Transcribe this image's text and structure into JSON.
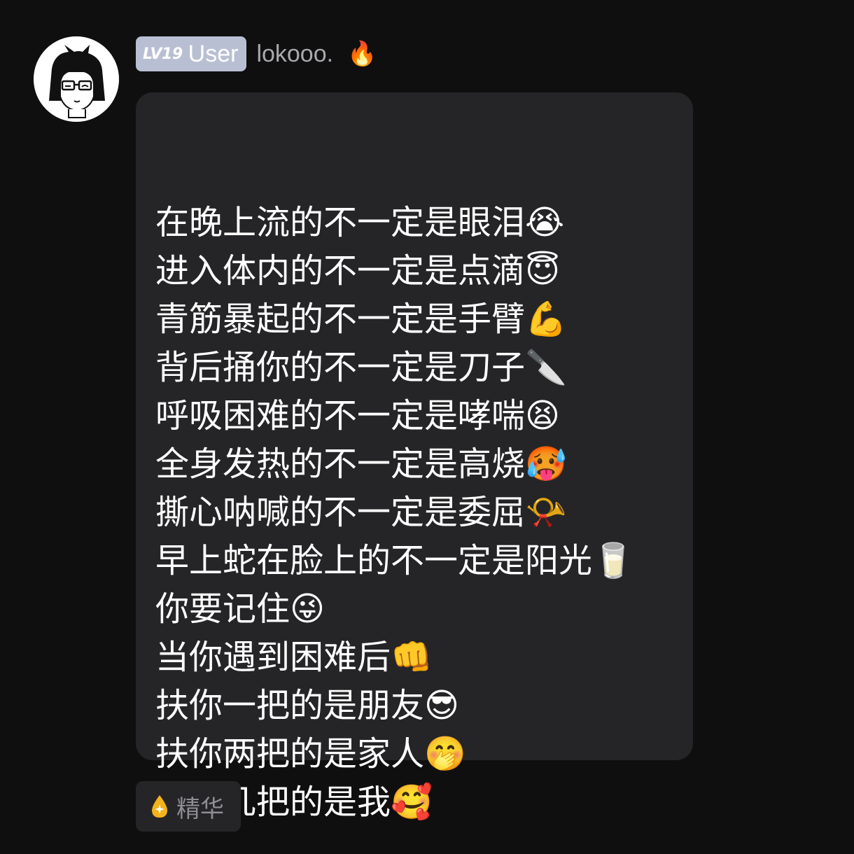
{
  "post": {
    "level": "LV19",
    "role": "User",
    "username": "lokooo.",
    "badge_icon": "fire-icon",
    "lines": [
      "在晚上流的不一定是眼泪😭",
      "进入体内的不一定是点滴😇",
      "青筋暴起的不一定是手臂💪",
      "背后捅你的不一定是刀子🔪",
      "呼吸困难的不一定是哮喘😫",
      "全身发热的不一定是高烧🥵",
      "撕心呐喊的不一定是委屈📯",
      "早上蛇在脸上的不一定是阳光🥛",
      "你要记住😜",
      "当你遇到困难后👊",
      "扶你一把的是朋友😎",
      "扶你两把的是家人🤭",
      "扶你几把的是我🥰"
    ]
  },
  "tag": {
    "label": "精华",
    "icon": "essence-drop-icon"
  },
  "colors": {
    "background": "#0f0f10",
    "bubble": "#252527",
    "level_badge": "#b9bfd3",
    "username": "#a9a9ad",
    "tag_text": "#8e8e93"
  }
}
